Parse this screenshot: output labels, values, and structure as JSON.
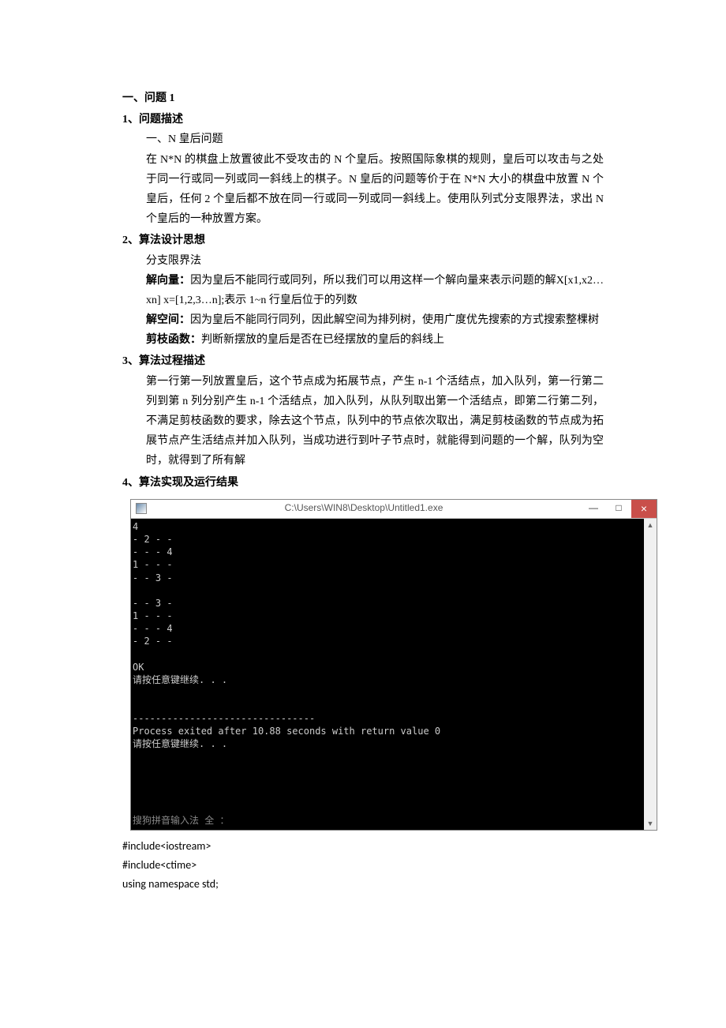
{
  "h1": "一、问题 1",
  "sec1": {
    "title": "1、问题描述",
    "sub": "一、N 皇后问题",
    "p": "在 N*N 的棋盘上放置彼此不受攻击的 N 个皇后。按照国际象棋的规则，皇后可以攻击与之处于同一行或同一列或同一斜线上的棋子。N 皇后的问题等价于在 N*N 大小的棋盘中放置 N 个皇后，任何 2 个皇后都不放在同一行或同一列或同一斜线上。使用队列式分支限界法，求出 N 个皇后的一种放置方案。"
  },
  "sec2": {
    "title": "2、算法设计思想",
    "sub": "分支限界法",
    "l1b": "解向量：",
    "l1": "因为皇后不能同行或同列，所以我们可以用这样一个解向量来表示问题的解X[x1,x2…xn] x=[1,2,3…n];表示 1~n 行皇后位于的列数",
    "l2b": "解空间：",
    "l2": "因为皇后不能同行同列，因此解空间为排列树，使用广度优先搜索的方式搜索整棵树",
    "l3b": "剪枝函数：",
    "l3": "判断新摆放的皇后是否在已经摆放的皇后的斜线上"
  },
  "sec3": {
    "title": "3、算法过程描述",
    "p": "第一行第一列放置皇后，这个节点成为拓展节点，产生 n-1 个活结点，加入队列，第一行第二列到第 n 列分别产生 n-1 个活结点，加入队列，从队列取出第一个活结点，即第二行第二列，不满足剪枝函数的要求，除去这个节点，队列中的节点依次取出，满足剪枝函数的节点成为拓展节点产生活结点并加入队列，当成功进行到叶子节点时，就能得到问题的一个解，队列为空时，就得到了所有解"
  },
  "sec4": {
    "title": "4、算法实现及运行结果"
  },
  "console": {
    "title": "C:\\Users\\WIN8\\Desktop\\Untitled1.exe",
    "line01": "4",
    "line02": "- 2 - -",
    "line03": "- - - 4",
    "line04": "1 - - -",
    "line05": "- - 3 -",
    "line06": "",
    "line07": "- - 3 -",
    "line08": "1 - - -",
    "line09": "- - - 4",
    "line10": "- 2 - -",
    "line11": "",
    "line12": "OK",
    "line13": "请按任意键继续. . .",
    "line14": "",
    "line15": "",
    "line16": "--------------------------------",
    "line17": "Process exited after 10.88 seconds with return value 0",
    "line18": "请按任意键继续. . .",
    "blank": "",
    "ime": "搜狗拼音输入法 全 ："
  },
  "controls": {
    "min": "—",
    "max": "□",
    "close": "×"
  },
  "code": {
    "l1": "#include<iostream>",
    "l2": "#include<ctime>",
    "l3": "using namespace std;"
  }
}
